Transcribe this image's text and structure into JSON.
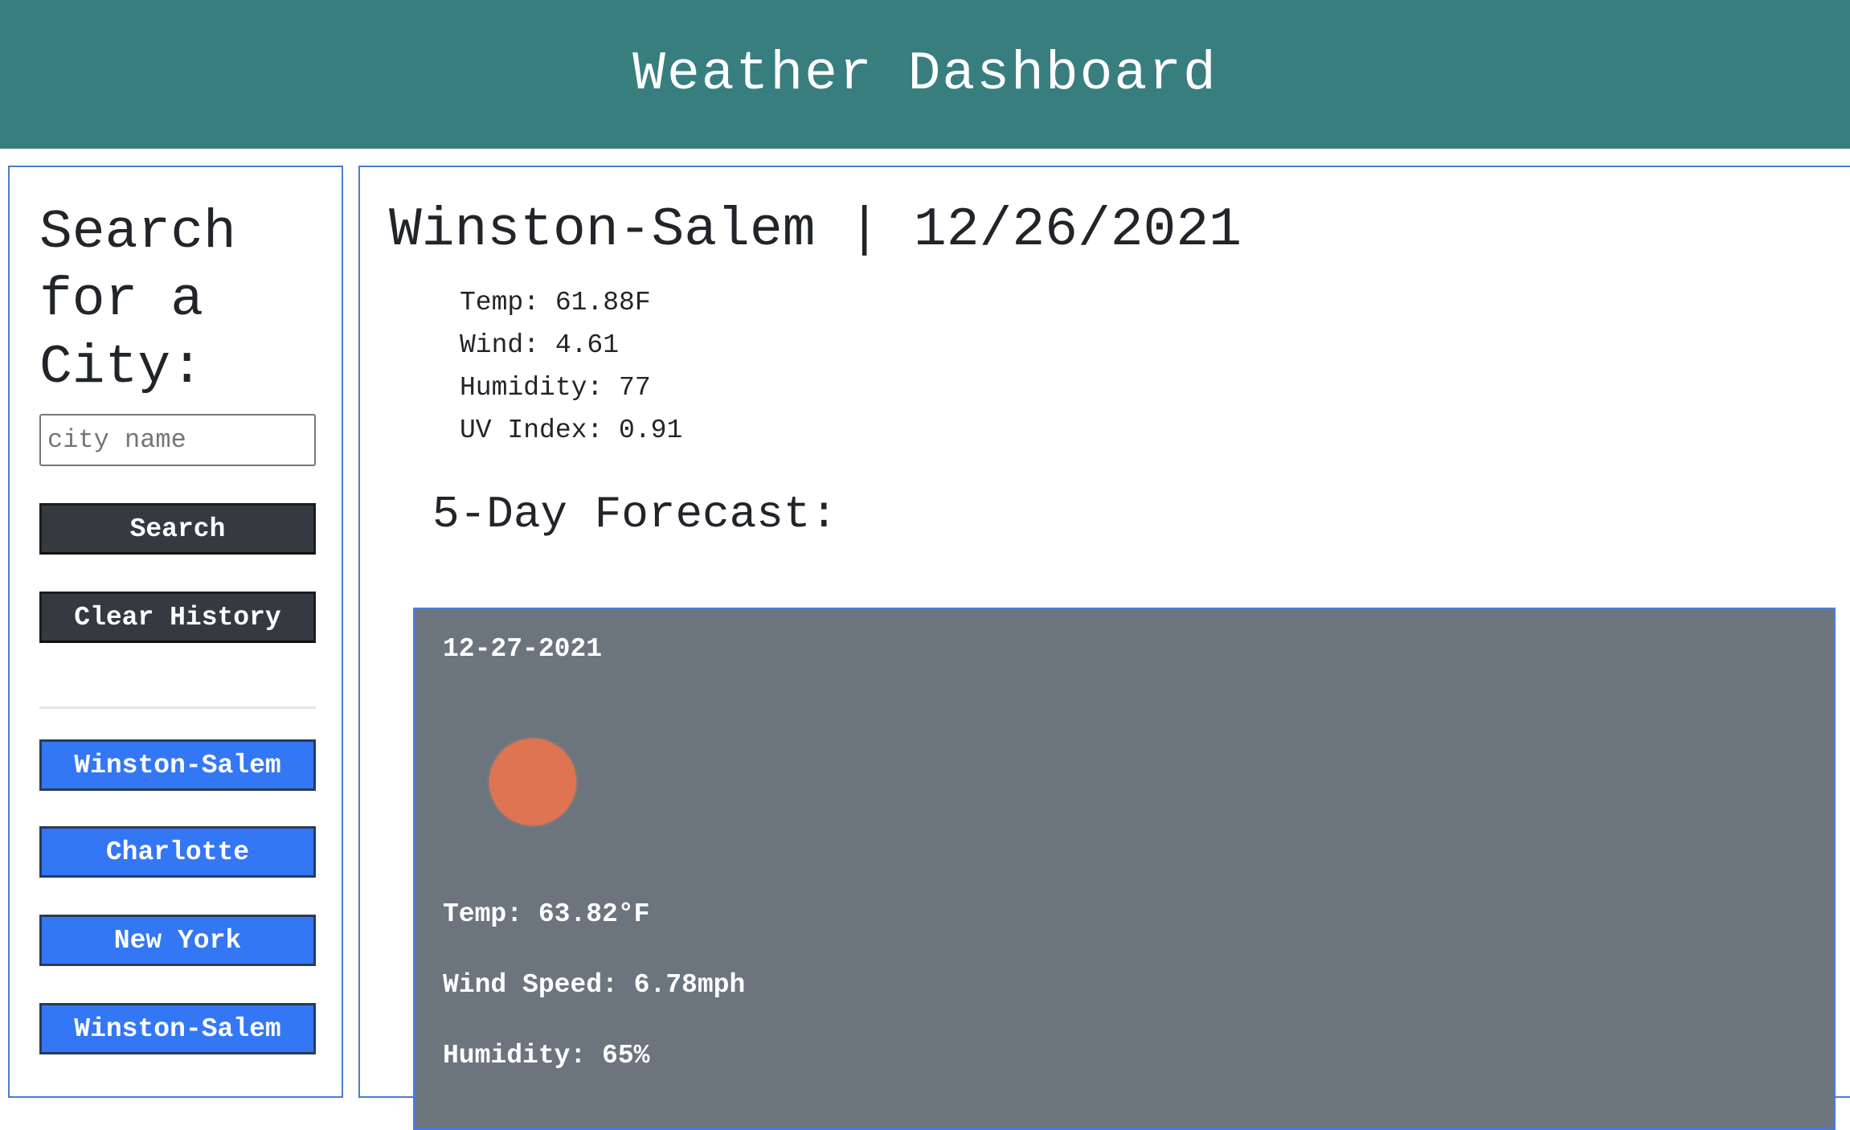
{
  "header": {
    "title": "Weather Dashboard"
  },
  "sidebar": {
    "heading": "Search for a City:",
    "search_placeholder": "city name",
    "search_button": "Search",
    "clear_button": "Clear History",
    "history": [
      {
        "label": "Winston-Salem"
      },
      {
        "label": "Charlotte"
      },
      {
        "label": "New York"
      },
      {
        "label": "Winston-Salem"
      }
    ]
  },
  "current": {
    "title": "Winston-Salem | 12/26/2021",
    "temp": "Temp: 61.88F",
    "wind": "Wind: 4.61",
    "humidity": "Humidity: 77",
    "uv": "UV Index: 0.91"
  },
  "forecast": {
    "heading": "5-Day Forecast:",
    "days": [
      {
        "date": "12-27-2021",
        "icon": "sun-icon",
        "temp": "Temp: 63.82°F",
        "wind": "Wind Speed: 6.78mph",
        "humidity": "Humidity: 65%"
      }
    ]
  },
  "colors": {
    "header_bg": "#387e7e",
    "dark_button": "#343a40",
    "history_button": "#3377f5",
    "card_bg": "#6c757d",
    "border_accent": "#4a7bd6",
    "sun": "#de7452"
  }
}
